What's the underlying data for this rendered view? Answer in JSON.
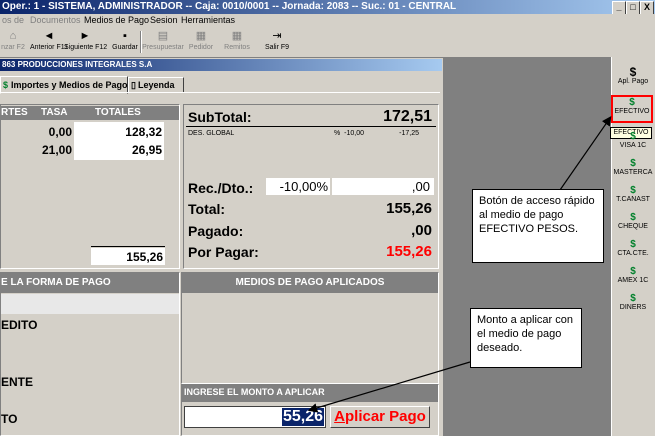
{
  "window": {
    "title": "Oper.: 1 - SISTEMA, ADMINISTRADOR  --  Caja: 0010/0001  --  Jornada: 2083  --  Suc.: 01 - CENTRAL",
    "min": "_",
    "max": "□",
    "close": "X"
  },
  "menu": [
    "os de",
    "Documentos",
    "Medios de Pago",
    "Sesion",
    "Herramientas"
  ],
  "toolbar": [
    {
      "label": "nzar F2",
      "icon": "⌂",
      "enabled": false
    },
    {
      "label": "Anterior F11",
      "icon": "◄",
      "enabled": true
    },
    {
      "label": "Siguiente F12",
      "icon": "►",
      "enabled": true
    },
    {
      "label": "Guardar",
      "icon": "▪",
      "enabled": true
    },
    {
      "label": "Presupuestar",
      "icon": "▤",
      "enabled": false
    },
    {
      "label": "Pedidor",
      "icon": "▦",
      "enabled": false
    },
    {
      "label": "Remitos",
      "icon": "▦",
      "enabled": false
    },
    {
      "label": "Salir F9",
      "icon": "⇥",
      "enabled": true
    }
  ],
  "form": {
    "title": "863 PRODUCCIONES INTEGRALES S.A",
    "tabs": [
      "Importes y Medios de Pago",
      "Leyenda"
    ],
    "importes": {
      "headers": [
        "RTES",
        "TASA",
        "TOTALES"
      ],
      "rows": [
        {
          "tasa": "0,00",
          "total": "128,32"
        },
        {
          "tasa": "21,00",
          "total": "26,95"
        }
      ],
      "sum": "155,26"
    },
    "summary": {
      "subtotal_label": "SubTotal:",
      "subtotal_value": "172,51",
      "desc_label": "DES. GLOBAL",
      "desc_pct_label": "%",
      "desc_pct": "-10,00",
      "desc_value": "-17,25",
      "rec_label": "Rec./Dto.:",
      "rec_pct": "-10,00%",
      "rec_value": ",00",
      "total_label": "Total:",
      "total_value": "155,26",
      "pagado_label": "Pagado:",
      "pagado_value": ",00",
      "porpagar_label": "Por Pagar:",
      "porpagar_value": "155,26"
    },
    "forma_pago": {
      "header": "E LA FORMA DE PAGO",
      "items": [
        "EDITO",
        "ENTE",
        "TO"
      ]
    },
    "medios": {
      "header": "MEDIOS DE PAGO APLICADOS"
    },
    "monto": {
      "header": "INGRESE EL MONTO A APLICAR",
      "value": "55,26",
      "apply_button": "Aplicar Pago",
      "apply_accel": "A"
    }
  },
  "rightbar": [
    {
      "label": "Apl. Pago",
      "icon": "$"
    },
    {
      "label": "EFECTIVO",
      "icon": "$"
    },
    {
      "label": "VISA 1C",
      "icon": "$"
    },
    {
      "label": "MASTERCA",
      "icon": "$"
    },
    {
      "label": "T.CANAST",
      "icon": "$"
    },
    {
      "label": "CHEQUE",
      "icon": "$"
    },
    {
      "label": "CTA.CTE.",
      "icon": "$"
    },
    {
      "label": "AMEX 1C",
      "icon": "$"
    },
    {
      "label": "DINERS",
      "icon": "$"
    }
  ],
  "tooltip": "EFECTIVO",
  "callouts": [
    {
      "text": "Botón de acceso rápido al medio de pago EFECTIVO PESOS."
    },
    {
      "text": "Monto a aplicar con el medio de pago deseado."
    }
  ],
  "colors": {
    "titlebar": "#0a246a",
    "porpagar": "#ff0000",
    "apply": "#ff0000",
    "highlight": "#ff0000",
    "money_icon": "#00802b"
  }
}
